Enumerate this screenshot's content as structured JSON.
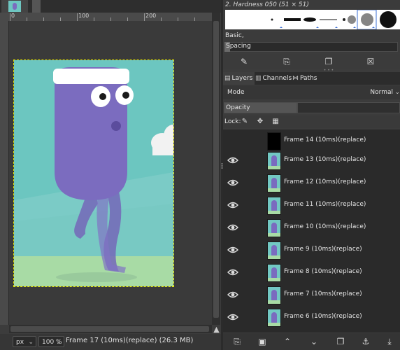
{
  "brushes": {
    "title": "2. Hardness 050 (51 × 51)",
    "preset_name": "Basic,",
    "spacing_label": "Spacing"
  },
  "dock_tabs": [
    {
      "label": "Layers",
      "active": true,
      "icon": "layers-icon"
    },
    {
      "label": "Channels",
      "active": false,
      "icon": "channels-icon"
    },
    {
      "label": "Paths",
      "active": false,
      "icon": "paths-icon"
    }
  ],
  "layers_panel": {
    "mode_label": "Mode",
    "mode_value": "Normal",
    "opacity_label": "Opacity",
    "lock_label": "Lock:"
  },
  "layers": [
    {
      "name": "Frame 14  (10ms)(replace)",
      "visible": false,
      "thumb": "dark"
    },
    {
      "name": "Frame 13  (10ms)(replace)",
      "visible": true,
      "thumb": "frame"
    },
    {
      "name": "Frame 12  (10ms)(replace)",
      "visible": true,
      "thumb": "frame"
    },
    {
      "name": "Frame 11  (10ms)(replace)",
      "visible": true,
      "thumb": "frame"
    },
    {
      "name": "Frame 10  (10ms)(replace)",
      "visible": true,
      "thumb": "frame"
    },
    {
      "name": "Frame 9  (10ms)(replace)",
      "visible": true,
      "thumb": "frame"
    },
    {
      "name": "Frame 8  (10ms)(replace)",
      "visible": true,
      "thumb": "frame"
    },
    {
      "name": "Frame 7  (10ms)(replace)",
      "visible": true,
      "thumb": "frame"
    },
    {
      "name": "Frame 6  (10ms)(replace)",
      "visible": true,
      "thumb": "frame"
    }
  ],
  "ruler": {
    "labels": [
      "0",
      "100",
      "200"
    ]
  },
  "statusbar": {
    "unit": "px",
    "zoom": "100 %",
    "status_text": "Frame 17  (10ms)(replace) (26.3 MB)"
  },
  "colors": {
    "canvas_sky": "#6cc6c0",
    "character": "#7b6cbf",
    "ground": "#a8dba5"
  }
}
